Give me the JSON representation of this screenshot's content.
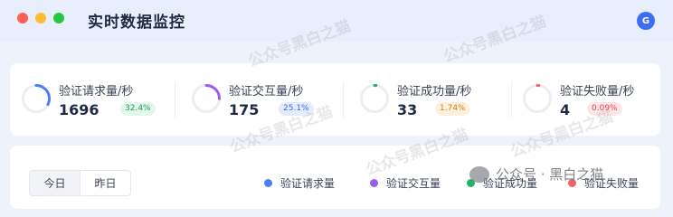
{
  "window": {
    "title": "实时数据监控",
    "avatar_letter": "G"
  },
  "stats": [
    {
      "label": "验证请求量/秒",
      "value": "1696",
      "percent_label": "32.4%",
      "ring_fraction": 0.324,
      "color": "#4d7ef7",
      "badge_bg": "#e3f8ec",
      "badge_fg": "#1f9e57"
    },
    {
      "label": "验证交互量/秒",
      "value": "175",
      "percent_label": "25.1%",
      "ring_fraction": 0.251,
      "color": "#9b5cf2",
      "badge_bg": "#e4ecfd",
      "badge_fg": "#3d6df2"
    },
    {
      "label": "验证成功量/秒",
      "value": "33",
      "percent_label": "1.74%",
      "ring_fraction": 0.0174,
      "color": "#23b26a",
      "badge_bg": "#fdf0dd",
      "badge_fg": "#d1821b"
    },
    {
      "label": "验证失败量/秒",
      "value": "4",
      "percent_label": "0.09%",
      "ring_fraction": 0.0009,
      "color": "#f0656b",
      "badge_bg": "#fde6e7",
      "badge_fg": "#e0464d"
    }
  ],
  "tabs": [
    {
      "label": "今日",
      "active": true
    },
    {
      "label": "昨日",
      "active": false
    }
  ],
  "legend": [
    {
      "label": "验证请求量",
      "color": "#4d7ef7"
    },
    {
      "label": "验证交互量",
      "color": "#9b5cf2"
    },
    {
      "label": "验证成功量",
      "color": "#23b26a"
    },
    {
      "label": "验证失败量",
      "color": "#f0656b"
    }
  ],
  "watermark": {
    "text": "公众号黑白之猫",
    "brand_text": "公众号 · 黑白之猫"
  }
}
